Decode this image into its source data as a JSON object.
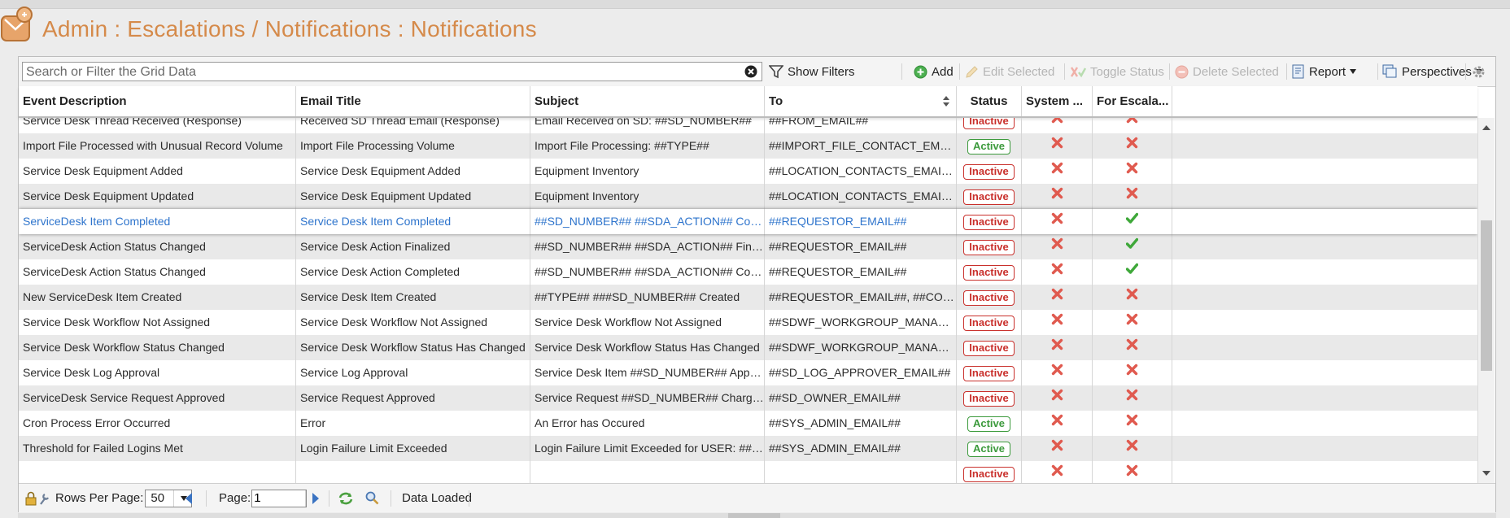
{
  "page": {
    "title": "Admin : Escalations / Notifications : Notifications"
  },
  "toolbar": {
    "search_placeholder": "Search or Filter the Grid Data",
    "show_filters": "Show Filters",
    "add": "Add",
    "edit_selected": "Edit Selected",
    "toggle_status": "Toggle Status",
    "delete_selected": "Delete Selected",
    "report": "Report",
    "perspectives": "Perspectives"
  },
  "columns": [
    "Event Description",
    "Email Title",
    "Subject",
    "To",
    "Status",
    "System ...",
    "For Escala..."
  ],
  "rows": [
    {
      "event": "Service Desk Thread Received (Response)",
      "title": "Received SD Thread Email (Response)",
      "subject": "Email Received on SD: ##SD_NUMBER##",
      "to": "##FROM_EMAIL##",
      "status": "Inactive",
      "system": false,
      "escalation": false
    },
    {
      "event": "Import File Processed with Unusual Record Volume",
      "title": "Import File Processing Volume",
      "subject": "Import File Processing: ##TYPE##",
      "to": "##IMPORT_FILE_CONTACT_EMAIL##",
      "status": "Active",
      "system": false,
      "escalation": false
    },
    {
      "event": "Service Desk Equipment Added",
      "title": "Service Desk Equipment Added",
      "subject": "Equipment Inventory",
      "to": "##LOCATION_CONTACTS_EMAIL##",
      "status": "Inactive",
      "system": false,
      "escalation": false
    },
    {
      "event": "Service Desk Equipment Updated",
      "title": "Service Desk Equipment Updated",
      "subject": "Equipment Inventory",
      "to": "##LOCATION_CONTACTS_EMAIL##",
      "status": "Inactive",
      "system": false,
      "escalation": false
    },
    {
      "event": "ServiceDesk Item Completed",
      "title": "Service Desk Item Completed",
      "subject": "##SD_NUMBER## ##SDA_ACTION## Completed",
      "to": "##REQUESTOR_EMAIL##",
      "status": "Inactive",
      "system": false,
      "escalation": true,
      "selected": true
    },
    {
      "event": "ServiceDesk Action Status Changed",
      "title": "Service Desk Action Finalized",
      "subject": "##SD_NUMBER## ##SDA_ACTION## Finalized",
      "to": "##REQUESTOR_EMAIL##",
      "status": "Inactive",
      "system": false,
      "escalation": true
    },
    {
      "event": "ServiceDesk Action Status Changed",
      "title": "Service Desk Action Completed",
      "subject": "##SD_NUMBER## ##SDA_ACTION## Completed",
      "to": "##REQUESTOR_EMAIL##",
      "status": "Inactive",
      "system": false,
      "escalation": true
    },
    {
      "event": "New ServiceDesk Item Created",
      "title": "Service Desk Item Created",
      "subject": "##TYPE## ###SD_NUMBER## Created",
      "to": "##REQUESTOR_EMAIL##, ##CONTA...",
      "status": "Inactive",
      "system": false,
      "escalation": false
    },
    {
      "event": "Service Desk Workflow Not Assigned",
      "title": "Service Desk Workflow Not Assigned",
      "subject": "Service Desk Workflow Not Assigned",
      "to": "##SDWF_WORKGROUP_MANAGER_...",
      "status": "Inactive",
      "system": false,
      "escalation": false
    },
    {
      "event": "Service Desk Workflow Status Changed",
      "title": "Service Desk Workflow Status Has Changed",
      "subject": "Service Desk Workflow Status Has Changed",
      "to": "##SDWF_WORKGROUP_MANAGER_...",
      "status": "Inactive",
      "system": false,
      "escalation": false
    },
    {
      "event": "Service Desk Log Approval",
      "title": "Service Log Approval",
      "subject": "Service Desk Item ##SD_NUMBER## Approved",
      "to": "##SD_LOG_APPROVER_EMAIL##",
      "status": "Inactive",
      "system": false,
      "escalation": false
    },
    {
      "event": "ServiceDesk Service Request Approved",
      "title": "Service Request Approved",
      "subject": "Service Request ##SD_NUMBER## Charge Acco...",
      "to": "##SD_OWNER_EMAIL##",
      "status": "Inactive",
      "system": false,
      "escalation": false
    },
    {
      "event": "Cron Process Error Occurred",
      "title": "Error",
      "subject": "An Error has Occured",
      "to": "##SYS_ADMIN_EMAIL##",
      "status": "Active",
      "system": false,
      "escalation": false
    },
    {
      "event": "Threshold for Failed Logins Met",
      "title": "Login Failure Limit Exceeded",
      "subject": "Login Failure Limit Exceeded for USER: ##USER...",
      "to": "##SYS_ADMIN_EMAIL##",
      "status": "Active",
      "system": false,
      "escalation": false
    },
    {
      "event": "",
      "title": "",
      "subject": "",
      "to": "",
      "status": "Inactive",
      "system": false,
      "escalation": false
    }
  ],
  "footer": {
    "rows_per_page_label": "Rows Per Page:",
    "rows_per_page": "50",
    "page_label": "Page:",
    "page_value": "1",
    "status": "Data Loaded"
  },
  "colors": {
    "title": "#d58a4a",
    "inactive": "#c9302c",
    "active": "#3c9a3c",
    "selected_text": "#2e74cc"
  }
}
